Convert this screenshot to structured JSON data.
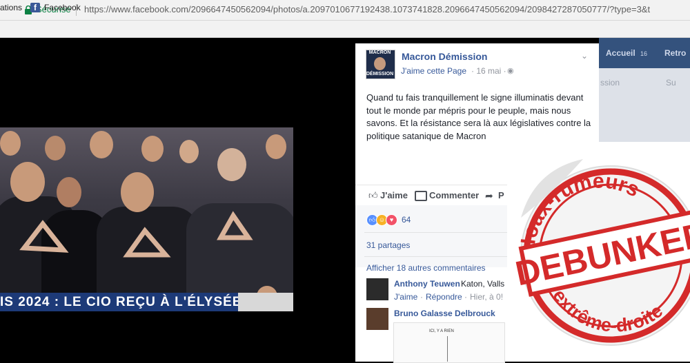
{
  "browser": {
    "secure_label": "Sécurisé",
    "url": "https://www.facebook.com/2096647450562094/photos/a.2097010677192438.1073741828.2096647450562094/2098427287050777/?type=3&t",
    "bookmarks": [
      {
        "label": "ations"
      },
      {
        "label": "Facebook"
      }
    ]
  },
  "photo": {
    "banner_text": "IS 2024 : LE CIO REÇU À L'ÉLYSÉE"
  },
  "fb_header": {
    "accueil": "Accueil",
    "accueil_count": "16",
    "retrouver": "Retro",
    "side_text": "ssion",
    "side_text2": "Su"
  },
  "post": {
    "avatar_line1": "MACRON",
    "avatar_line2": "DÉMISSION",
    "page_name": "Macron Démission",
    "like_page": "J'aime cette Page",
    "date": "· 16 mai ·",
    "text": "Quand tu fais tranquillement le signe illuminatis devant tout le monde par mépris pour le peuple, mais nous savons. Et la résistance sera là aux législatives contre la politique satanique de Macron",
    "actions": {
      "like": "J'aime",
      "comment": "Commenter",
      "share": "P"
    },
    "reaction_count": "64",
    "shares": "31 partages",
    "more_comments": "Afficher 18 autres commentaires",
    "comments": [
      {
        "name": "Anthony Teuwen",
        "text": "Katon, Valls",
        "like": "J'aime",
        "reply": "Répondre",
        "time": "Hier, à 0!"
      },
      {
        "name": "Bruno Galasse Delbrouck",
        "image_caption": "ICI, Y A RIEN"
      }
    ]
  },
  "stamp": {
    "top_text": "Hoax-rumeurs",
    "center_text": "DEBUNKED",
    "bottom_text": "d'extrême-droite",
    "color": "#d42a2a"
  }
}
